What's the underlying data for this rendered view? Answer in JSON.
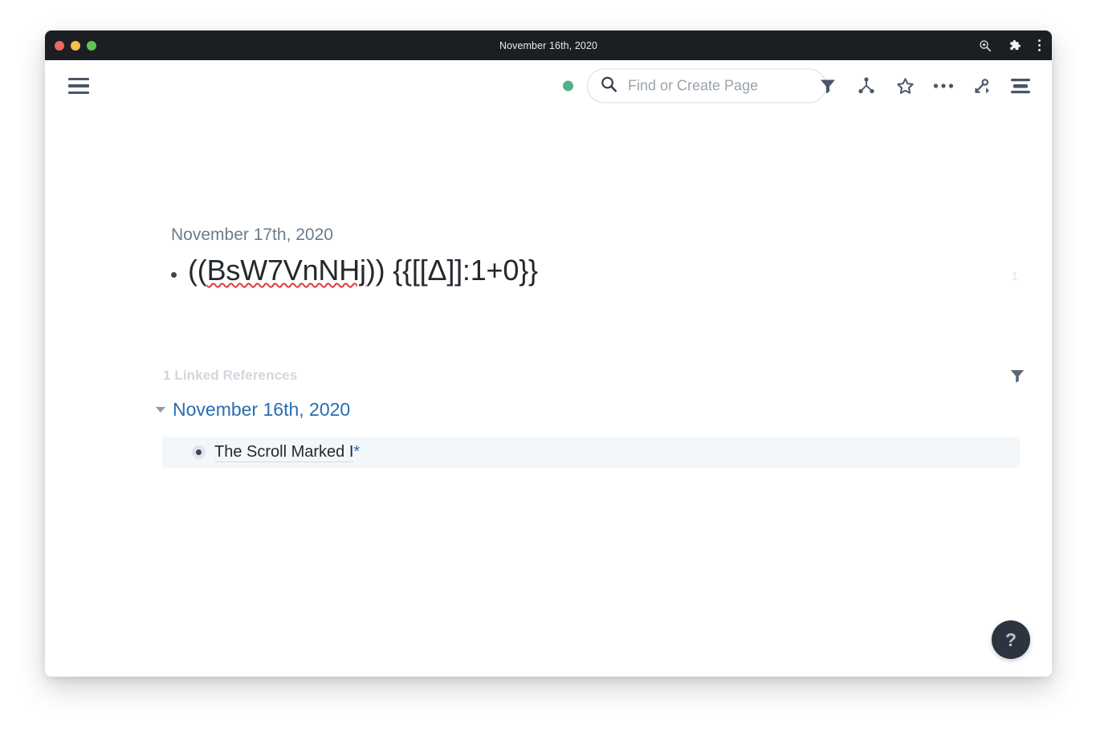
{
  "window": {
    "title_bar": {
      "title": "November 16th, 2020",
      "traffic_lights": [
        {
          "name": "close",
          "color": "#ec6a5f"
        },
        {
          "name": "minimize",
          "color": "#f4bd4f"
        },
        {
          "name": "zoom",
          "color": "#61c554"
        }
      ],
      "actions": [
        {
          "name": "zoom-search-icon",
          "label": "Zoom"
        },
        {
          "name": "extension-puzzle-icon",
          "label": "Extensions"
        },
        {
          "name": "overflow-menu-icon",
          "label": "More"
        }
      ]
    },
    "top_bar": {
      "menu_label": "Main menu",
      "status_dot_color": "#53b187",
      "search": {
        "placeholder": "Find or Create Page",
        "value": ""
      },
      "actions": [
        {
          "name": "filter-icon",
          "label": "Filter"
        },
        {
          "name": "graph-overview-icon",
          "label": "Graph Overview"
        },
        {
          "name": "star-icon",
          "label": "Add to Shortcuts"
        },
        {
          "name": "ellipsis-icon",
          "label": "More Options"
        },
        {
          "name": "pointer-arrow-icon",
          "label": "Daily Notes"
        },
        {
          "name": "right-sidebar-icon",
          "label": "Toggle Right Sidebar"
        }
      ]
    },
    "main": {
      "page_date": "November 17th, 2020",
      "block": {
        "text_block_ref": "((BsW7VnNHj))",
        "text_misspelled": "BsW7VnNHj",
        "text_prefix": "((",
        "text_suffix": ")) ",
        "text_query": "{{[[Δ]]:1+0}}",
        "reference_count": "1"
      },
      "linked_references": {
        "title": "1 Linked References",
        "filter_label": "Filter references",
        "groups": [
          {
            "date": "November 16th, 2020",
            "expanded": true,
            "items": [
              {
                "text": "The Scroll Marked I",
                "suffix": "*"
              }
            ]
          }
        ]
      },
      "help_button": {
        "glyph": "?",
        "label": "Help"
      }
    }
  },
  "colors": {
    "accent_link": "#2b6cb0",
    "titlebar_bg": "#1b1e23",
    "status_green": "#53b187",
    "spellcheck_red": "#e23b3b",
    "row_highlight": "#f4f7fa"
  }
}
